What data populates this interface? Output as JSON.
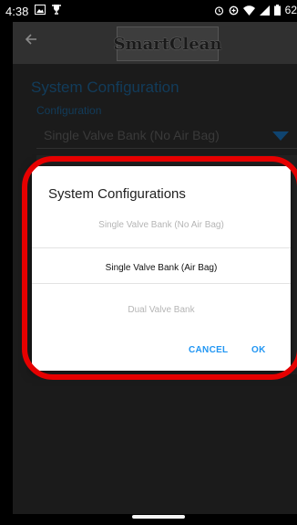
{
  "status_bar": {
    "time": "4:38",
    "battery": "62"
  },
  "app_bar": {
    "logo_text": "SmartClean"
  },
  "screen": {
    "section_title": "System Configuration",
    "field_label": "Configuration",
    "field_value": "Single Valve Bank (No Air Bag)"
  },
  "dialog": {
    "title": "System Configurations",
    "options": [
      {
        "label": "Single Valve Bank (No Air Bag)",
        "selected": false
      },
      {
        "label": "Single Valve Bank (Air Bag)",
        "selected": true
      },
      {
        "label": "Dual Valve Bank",
        "selected": false
      }
    ],
    "cancel_label": "CANCEL",
    "ok_label": "OK"
  },
  "colors": {
    "accent": "#2196f3",
    "highlight": "#e60000",
    "title_blue": "#123c5b"
  }
}
